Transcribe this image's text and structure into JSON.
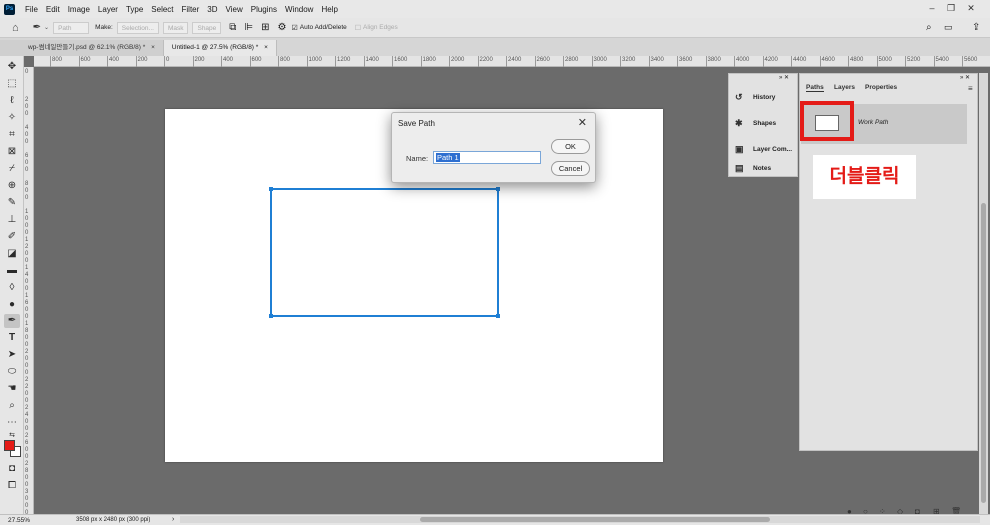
{
  "app": {
    "logo": "Ps",
    "menu": [
      "File",
      "Edit",
      "Image",
      "Layer",
      "Type",
      "Select",
      "Filter",
      "3D",
      "View",
      "Plugins",
      "Window",
      "Help"
    ]
  },
  "options_bar": {
    "mode": "Path",
    "make_label": "Make:",
    "selection": "Selection...",
    "mask": "Mask",
    "shape": "Shape",
    "auto_add_delete": "Auto Add/Delete",
    "align_edges": "Align Edges"
  },
  "tabs": [
    {
      "label": "wp-썸네일만들기.psd @ 62.1% (RGB/8) *",
      "close": "×"
    },
    {
      "label": "Untitled-1 @ 27.5% (RGB/8) *",
      "close": "×"
    }
  ],
  "ruler_top": [
    "800",
    "600",
    "400",
    "200",
    "0",
    "200",
    "400",
    "600",
    "800",
    "1000",
    "1200",
    "1400",
    "1600",
    "1800",
    "2000",
    "2200",
    "2400",
    "2600",
    "2800",
    "3000",
    "3200",
    "3400",
    "3600",
    "3800",
    "4000",
    "4200",
    "4400",
    "4600",
    "4800",
    "5000",
    "5200",
    "5400",
    "5600"
  ],
  "ruler_left": [
    "0",
    "200",
    "400",
    "600",
    "800",
    "1000",
    "1200",
    "1400",
    "1600",
    "1800",
    "2000",
    "2200",
    "2400",
    "2600",
    "2800",
    "3000"
  ],
  "dialog": {
    "title": "Save Path",
    "close": "✕",
    "name_label": "Name:",
    "name_value": "Path 1",
    "ok": "OK",
    "cancel": "Cancel"
  },
  "dock": [
    {
      "label": "History",
      "icon": "history-icon",
      "glyph": "↺"
    },
    {
      "label": "Shapes",
      "icon": "shapes-icon",
      "glyph": "✱"
    },
    {
      "label": "Layer Com...",
      "icon": "layer-comps-icon",
      "glyph": "▣"
    },
    {
      "label": "Notes",
      "icon": "notes-icon",
      "glyph": "▤"
    }
  ],
  "paths_panel": {
    "tabs": [
      "Paths",
      "Layers",
      "Properties"
    ],
    "menu": "≡",
    "path_name": "Work Path"
  },
  "annotation": "더블클릭",
  "status": {
    "zoom": "27.55%",
    "doc_info": "3508 px x 2480 px (300 ppi)",
    "arrow": "›"
  },
  "colors": {
    "foreground": "#e41b17",
    "background": "#ffffff",
    "path_stroke": "#1f7fd4",
    "highlight": "#e41b17"
  }
}
